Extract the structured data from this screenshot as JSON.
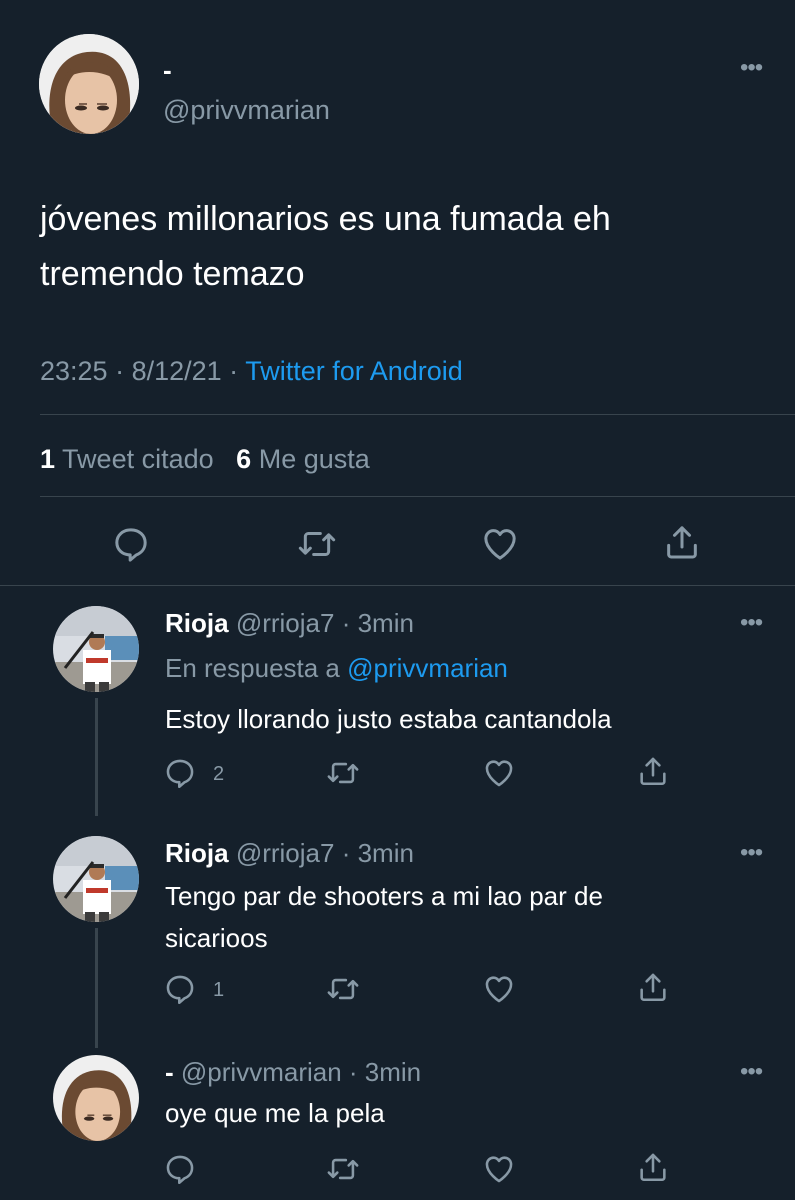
{
  "main_tweet": {
    "display_name": "-",
    "handle": "@privvmarian",
    "text_lines": [
      "jóvenes millonarios es una fumada eh",
      "tremendo temazo"
    ],
    "time": "23:25",
    "date": "8/12/21",
    "source": "Twitter for Android",
    "quote_count": "1",
    "quote_label": "Tweet citado",
    "like_count": "6",
    "like_label": "Me gusta"
  },
  "replies": [
    {
      "display_name": "Rioja",
      "handle": "@rrioja7",
      "time": "3min",
      "reply_to_label": "En respuesta a",
      "reply_to_handle": "@privvmarian",
      "text_lines": [
        "Estoy llorando justo estaba cantandola"
      ],
      "reply_count": "2"
    },
    {
      "display_name": "Rioja",
      "handle": "@rrioja7",
      "time": "3min",
      "text_lines": [
        "Tengo par de shooters a mi lao par de",
        "sicarioos"
      ],
      "reply_count": "1"
    },
    {
      "display_name": "-",
      "handle": "@privvmarian",
      "time": "3min",
      "text_lines": [
        "oye que me la pela"
      ],
      "reply_count": ""
    }
  ],
  "separator": " · ",
  "icons": {
    "more": "more-dots-icon",
    "reply": "reply-bubble-icon",
    "retweet": "retweet-icon",
    "like": "heart-icon",
    "share": "share-icon"
  },
  "colors": {
    "background": "#15202b",
    "text": "#ffffff",
    "secondary": "#8899a6",
    "accent": "#1d9bf0",
    "divider": "#38444d"
  }
}
